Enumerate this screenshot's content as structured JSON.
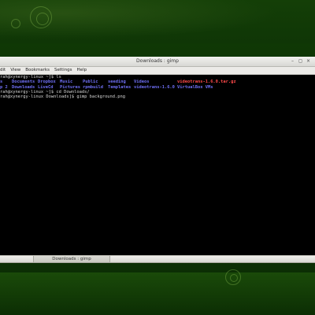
{
  "window": {
    "title": "Downloads : gimp",
    "close_glyph": "×",
    "restore_glyph": "◻",
    "minimize_glyph": "–"
  },
  "menubar": {
    "items": [
      "dit",
      "View",
      "Bookmarks",
      "Settings",
      "Help"
    ]
  },
  "terminal": {
    "line1": "rah@xynergy-linux ~]$ ls",
    "ls_row1": [
      {
        "text": "s",
        "kind": "dir"
      },
      {
        "text": "Documents",
        "kind": "dir"
      },
      {
        "text": "Dropbox",
        "kind": "dir"
      },
      {
        "text": "Music",
        "kind": "dir"
      },
      {
        "text": "Public",
        "kind": "dir"
      },
      {
        "text": "seeding",
        "kind": "dir"
      },
      {
        "text": "Videos",
        "kind": "dir"
      },
      {
        "text": "videotrans-1.6.0.tar.gz",
        "kind": "red"
      }
    ],
    "ls_row2": [
      {
        "text": "p 2",
        "kind": "dir"
      },
      {
        "text": "Downloads",
        "kind": "dir"
      },
      {
        "text": "LiveCd",
        "kind": "dir"
      },
      {
        "text": "Pictures",
        "kind": "dir"
      },
      {
        "text": "rpmbuild",
        "kind": "dir"
      },
      {
        "text": "Templates",
        "kind": "dir"
      },
      {
        "text": "videotrans-1.6.0",
        "kind": "dir"
      },
      {
        "text": "VirtualBox VMs",
        "kind": "dir"
      }
    ],
    "line4": "rah@xynergy-linux ~]$ cd Downloads/",
    "line5": "rah@xynergy-linux Downloads]$ gimp background.png"
  },
  "taskbar": {
    "task_label": "Downloads : gimp"
  },
  "colors": {
    "directory": "#6f6ff5",
    "archive": "#ff4a4a",
    "desktop_green": "#0f3606"
  }
}
